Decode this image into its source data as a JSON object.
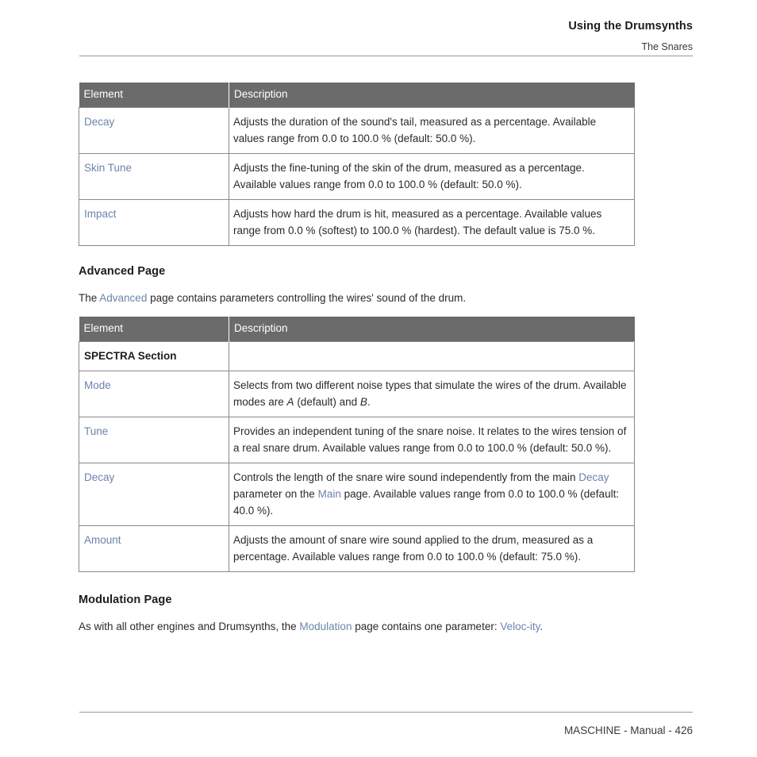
{
  "header": {
    "title": "Using the Drumsynths",
    "subtitle": "The Snares"
  },
  "footer": {
    "text": "MASCHINE - Manual - 426"
  },
  "colors": {
    "link": "#6b84ab",
    "table_header_bg": "#6b6b6b",
    "table_header_text": "#ffffff",
    "body_text": "#2a2a2a",
    "rule": "#9a9a9a",
    "border": "#8a8a8a"
  },
  "tables": {
    "main_page": {
      "columns": [
        "Element",
        "Description"
      ],
      "rows": [
        {
          "element": "Decay",
          "element_is_link": true,
          "description": "Adjusts the duration of the sound's tail, measured as a percentage. Available values range from 0.0 to 100.0 % (default: 50.0 %)."
        },
        {
          "element": "Skin Tune",
          "element_is_link": true,
          "description": "Adjusts the fine-tuning of the skin of the drum, measured as a percentage. Available values range from 0.0 to 100.0 % (default: 50.0 %)."
        },
        {
          "element": "Impact",
          "element_is_link": true,
          "description": "Adjusts how hard the drum is hit, measured as a percentage. Available values range from 0.0 % (softest) to 100.0 % (hardest). The default value is 75.0 %."
        }
      ]
    },
    "advanced_page": {
      "columns": [
        "Element",
        "Description"
      ],
      "rows": [
        {
          "element": "SPECTRA Section",
          "element_is_link": false,
          "is_section_header": true,
          "description": ""
        },
        {
          "element": "Mode",
          "element_is_link": true,
          "description_parts": [
            {
              "text": "Selects from two different noise types that simulate the wires of the drum. Available modes are ",
              "style": "plain"
            },
            {
              "text": "A",
              "style": "italic"
            },
            {
              "text": " (default) and ",
              "style": "plain"
            },
            {
              "text": "B",
              "style": "italic"
            },
            {
              "text": ".",
              "style": "plain"
            }
          ]
        },
        {
          "element": "Tune",
          "element_is_link": true,
          "description": "Provides an independent tuning of the snare noise. It relates to the wires tension of a real snare drum. Available values range from 0.0 to 100.0 % (default: 50.0 %)."
        },
        {
          "element": "Decay",
          "element_is_link": true,
          "description_parts": [
            {
              "text": "Controls the length of the snare wire sound independently from the main ",
              "style": "plain"
            },
            {
              "text": "Decay",
              "style": "link"
            },
            {
              "text": " parameter on the ",
              "style": "plain"
            },
            {
              "text": "Main",
              "style": "link"
            },
            {
              "text": " page. Available values range from 0.0 to 100.0 % (default: 40.0 %).",
              "style": "plain"
            }
          ]
        },
        {
          "element": "Amount",
          "element_is_link": true,
          "description": "Adjusts the amount of snare wire sound applied to the drum, measured as a percentage. Available values range from 0.0 to 100.0 % (default: 75.0 %)."
        }
      ]
    }
  },
  "sections": {
    "advanced": {
      "heading": "Advanced Page",
      "paragraph_parts": [
        {
          "text": "The ",
          "style": "plain"
        },
        {
          "text": "Advanced",
          "style": "link"
        },
        {
          "text": " page contains parameters controlling the wires' sound of the drum.",
          "style": "plain"
        }
      ]
    },
    "modulation": {
      "heading": "Modulation Page",
      "paragraph_parts": [
        {
          "text": "As with all other engines and Drumsynths, the ",
          "style": "plain"
        },
        {
          "text": "Modulation",
          "style": "link"
        },
        {
          "text": " page contains one parameter: ",
          "style": "plain"
        },
        {
          "text": "Veloc-ity",
          "style": "link"
        },
        {
          "text": ".",
          "style": "plain"
        }
      ]
    }
  }
}
